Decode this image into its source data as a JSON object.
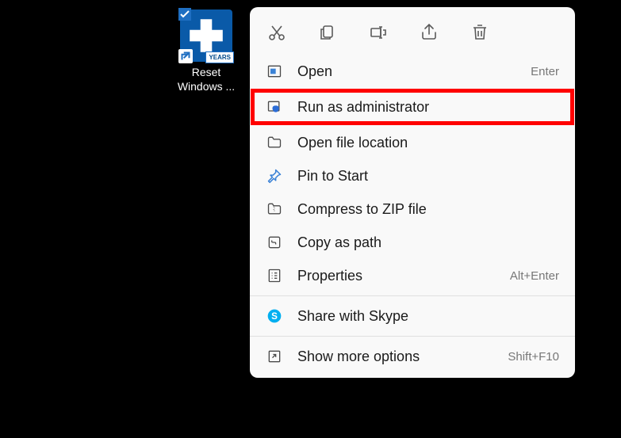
{
  "desktop_icon": {
    "label": "Reset\nWindows ...",
    "badge": "YEARS"
  },
  "toolbar": {
    "cut": "Cut",
    "copy": "Copy",
    "rename": "Rename",
    "share": "Share",
    "delete": "Delete"
  },
  "menu": {
    "open": {
      "label": "Open",
      "shortcut": "Enter"
    },
    "run_admin": {
      "label": "Run as administrator"
    },
    "open_location": {
      "label": "Open file location"
    },
    "pin_start": {
      "label": "Pin to Start"
    },
    "compress": {
      "label": "Compress to ZIP file"
    },
    "copy_path": {
      "label": "Copy as path"
    },
    "properties": {
      "label": "Properties",
      "shortcut": "Alt+Enter"
    },
    "share_skype": {
      "label": "Share with Skype"
    },
    "show_more": {
      "label": "Show more options",
      "shortcut": "Shift+F10"
    }
  }
}
